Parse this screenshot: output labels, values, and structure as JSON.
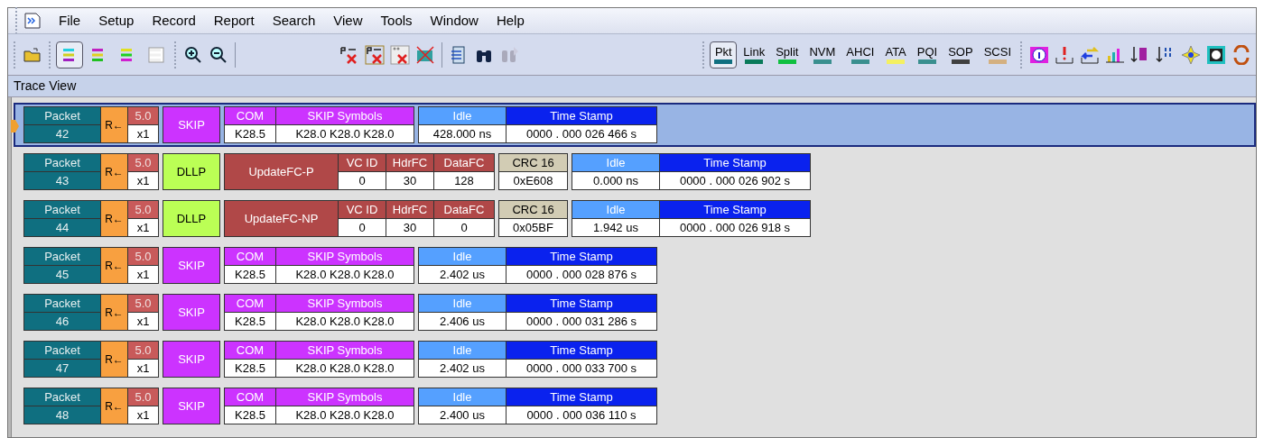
{
  "menu": [
    "File",
    "Setup",
    "Record",
    "Report",
    "Search",
    "View",
    "Tools",
    "Window",
    "Help"
  ],
  "view_buttons": [
    {
      "selected": true
    },
    {
      "selected": false
    },
    {
      "selected": false
    },
    {
      "selected": false
    }
  ],
  "protocol_buttons": [
    {
      "label": "Pkt",
      "color": "#0f6f80",
      "selected": true
    },
    {
      "label": "Link",
      "color": "#0a7a5a",
      "selected": false
    },
    {
      "label": "Split",
      "color": "#10c040",
      "selected": false
    },
    {
      "label": "NVM",
      "color": "#3a8f8f",
      "selected": false
    },
    {
      "label": "AHCI",
      "color": "#3a8f8f",
      "selected": false
    },
    {
      "label": "ATA",
      "color": "#f4f060",
      "selected": false
    },
    {
      "label": "PQI",
      "color": "#3a8f8f",
      "selected": false
    },
    {
      "label": "SOP",
      "color": "#404040",
      "selected": false
    },
    {
      "label": "SCSI",
      "color": "#d4b080",
      "selected": false
    }
  ],
  "panel_title": "Trace View",
  "packets": [
    {
      "header": "Packet",
      "number": "42",
      "direction": "R←",
      "speed": "5.0",
      "width": "x1",
      "selected": true,
      "type": {
        "kind": "skip",
        "label": "SKIP"
      },
      "blocks": [
        {
          "kind": "skip",
          "fields": [
            {
              "header": "COM",
              "value": "K28.5"
            },
            {
              "header": "SKIP Symbols",
              "value": "K28.0 K28.0 K28.0"
            }
          ]
        },
        {
          "kind": "timing",
          "fields": [
            {
              "header": "Idle",
              "value": "428.000 ns"
            },
            {
              "header": "Time Stamp",
              "value": "0000 . 000 026 466 s"
            }
          ]
        }
      ]
    },
    {
      "header": "Packet",
      "number": "43",
      "direction": "R←",
      "speed": "5.0",
      "width": "x1",
      "selected": false,
      "type": {
        "kind": "dllp",
        "label": "DLLP"
      },
      "blocks": [
        {
          "kind": "dllp",
          "title": "UpdateFC-P",
          "fields": [
            {
              "header": "VC ID",
              "value": "0"
            },
            {
              "header": "HdrFC",
              "value": "30"
            },
            {
              "header": "DataFC",
              "value": "128"
            }
          ]
        },
        {
          "kind": "crc",
          "fields": [
            {
              "header": "CRC 16",
              "value": "0xE608"
            }
          ]
        },
        {
          "kind": "timing",
          "fields": [
            {
              "header": "Idle",
              "value": "0.000 ns"
            },
            {
              "header": "Time Stamp",
              "value": "0000 . 000 026 902 s"
            }
          ]
        }
      ]
    },
    {
      "header": "Packet",
      "number": "44",
      "direction": "R←",
      "speed": "5.0",
      "width": "x1",
      "selected": false,
      "type": {
        "kind": "dllp",
        "label": "DLLP"
      },
      "blocks": [
        {
          "kind": "dllp",
          "title": "UpdateFC-NP",
          "fields": [
            {
              "header": "VC ID",
              "value": "0"
            },
            {
              "header": "HdrFC",
              "value": "30"
            },
            {
              "header": "DataFC",
              "value": "0"
            }
          ]
        },
        {
          "kind": "crc",
          "fields": [
            {
              "header": "CRC 16",
              "value": "0x05BF"
            }
          ]
        },
        {
          "kind": "timing",
          "fields": [
            {
              "header": "Idle",
              "value": "1.942 us"
            },
            {
              "header": "Time Stamp",
              "value": "0000 . 000 026 918 s"
            }
          ]
        }
      ]
    },
    {
      "header": "Packet",
      "number": "45",
      "direction": "R←",
      "speed": "5.0",
      "width": "x1",
      "selected": false,
      "type": {
        "kind": "skip",
        "label": "SKIP"
      },
      "blocks": [
        {
          "kind": "skip",
          "fields": [
            {
              "header": "COM",
              "value": "K28.5"
            },
            {
              "header": "SKIP Symbols",
              "value": "K28.0 K28.0 K28.0"
            }
          ]
        },
        {
          "kind": "timing",
          "fields": [
            {
              "header": "Idle",
              "value": "2.402 us"
            },
            {
              "header": "Time Stamp",
              "value": "0000 . 000 028 876 s"
            }
          ]
        }
      ]
    },
    {
      "header": "Packet",
      "number": "46",
      "direction": "R←",
      "speed": "5.0",
      "width": "x1",
      "selected": false,
      "type": {
        "kind": "skip",
        "label": "SKIP"
      },
      "blocks": [
        {
          "kind": "skip",
          "fields": [
            {
              "header": "COM",
              "value": "K28.5"
            },
            {
              "header": "SKIP Symbols",
              "value": "K28.0 K28.0 K28.0"
            }
          ]
        },
        {
          "kind": "timing",
          "fields": [
            {
              "header": "Idle",
              "value": "2.406 us"
            },
            {
              "header": "Time Stamp",
              "value": "0000 . 000 031 286 s"
            }
          ]
        }
      ]
    },
    {
      "header": "Packet",
      "number": "47",
      "direction": "R←",
      "speed": "5.0",
      "width": "x1",
      "selected": false,
      "type": {
        "kind": "skip",
        "label": "SKIP"
      },
      "blocks": [
        {
          "kind": "skip",
          "fields": [
            {
              "header": "COM",
              "value": "K28.5"
            },
            {
              "header": "SKIP Symbols",
              "value": "K28.0 K28.0 K28.0"
            }
          ]
        },
        {
          "kind": "timing",
          "fields": [
            {
              "header": "Idle",
              "value": "2.402 us"
            },
            {
              "header": "Time Stamp",
              "value": "0000 . 000 033 700 s"
            }
          ]
        }
      ]
    },
    {
      "header": "Packet",
      "number": "48",
      "direction": "R←",
      "speed": "5.0",
      "width": "x1",
      "selected": false,
      "type": {
        "kind": "skip",
        "label": "SKIP"
      },
      "blocks": [
        {
          "kind": "skip",
          "fields": [
            {
              "header": "COM",
              "value": "K28.5"
            },
            {
              "header": "SKIP Symbols",
              "value": "K28.0 K28.0 K28.0"
            }
          ]
        },
        {
          "kind": "timing",
          "fields": [
            {
              "header": "Idle",
              "value": "2.400 us"
            },
            {
              "header": "Time Stamp",
              "value": "0000 . 000 036 110 s"
            }
          ]
        }
      ]
    }
  ]
}
